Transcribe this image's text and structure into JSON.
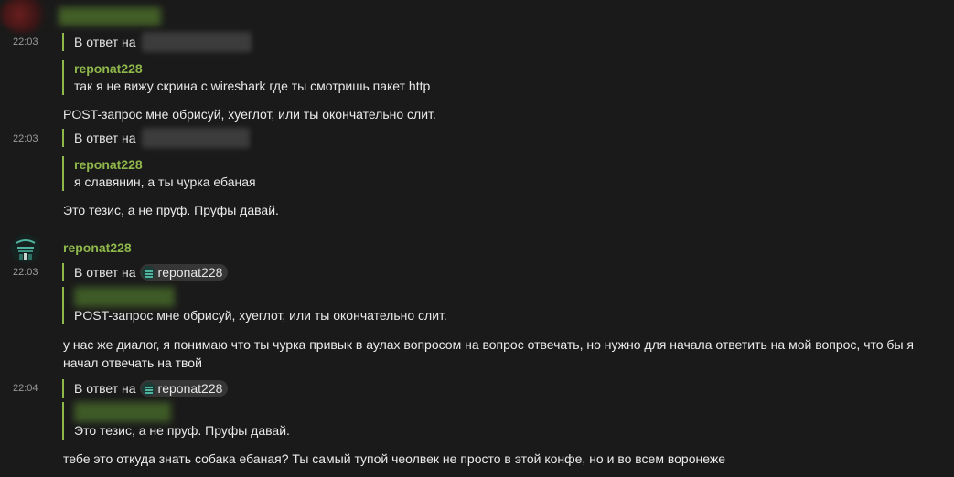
{
  "chat": {
    "reply_prefix": "В ответ на",
    "messages": [
      {
        "time": "22:03",
        "quote_author": "reponat228",
        "quote_text": "так я не вижу скрина с wireshark где ты смотришь пакет http",
        "text": "POST-запрос мне обрисуй, хуеглот, или ты окончательно слит."
      },
      {
        "time": "22:03",
        "quote_author": "reponat228",
        "quote_text": "я славянин, а ты чурка ебаная",
        "text": "Это тезис, а не пруф. Пруфы давай."
      },
      {
        "author": "reponat228",
        "time": "22:03",
        "reply_to": "reponat228",
        "quote_text": "POST-запрос мне обрисуй, хуеглот, или ты окончательно слит.",
        "text": "у нас же диалог, я понимаю что ты чурка привык в аулах вопросом на вопрос отвечать, но нужно для начала ответить на мой вопрос, что бы я начал отвечать на твой"
      },
      {
        "time": "22:04",
        "reply_to": "reponat228",
        "quote_text": "Это тезис, а не пруф. Пруфы давай.",
        "text": "тебе это откуда знать собака ебаная? Ты самый тупой чеолвек не просто в этой конфе, но и во всем воронеже"
      }
    ]
  },
  "colors": {
    "background": "#1a1a1a",
    "accent_green": "#8fb84a",
    "timestamp": "#9a9a9a",
    "chip_bg": "#363636"
  },
  "icons": {
    "user_avatar": "avatar-icon",
    "chip_avatar": "mini-avatar-icon"
  }
}
